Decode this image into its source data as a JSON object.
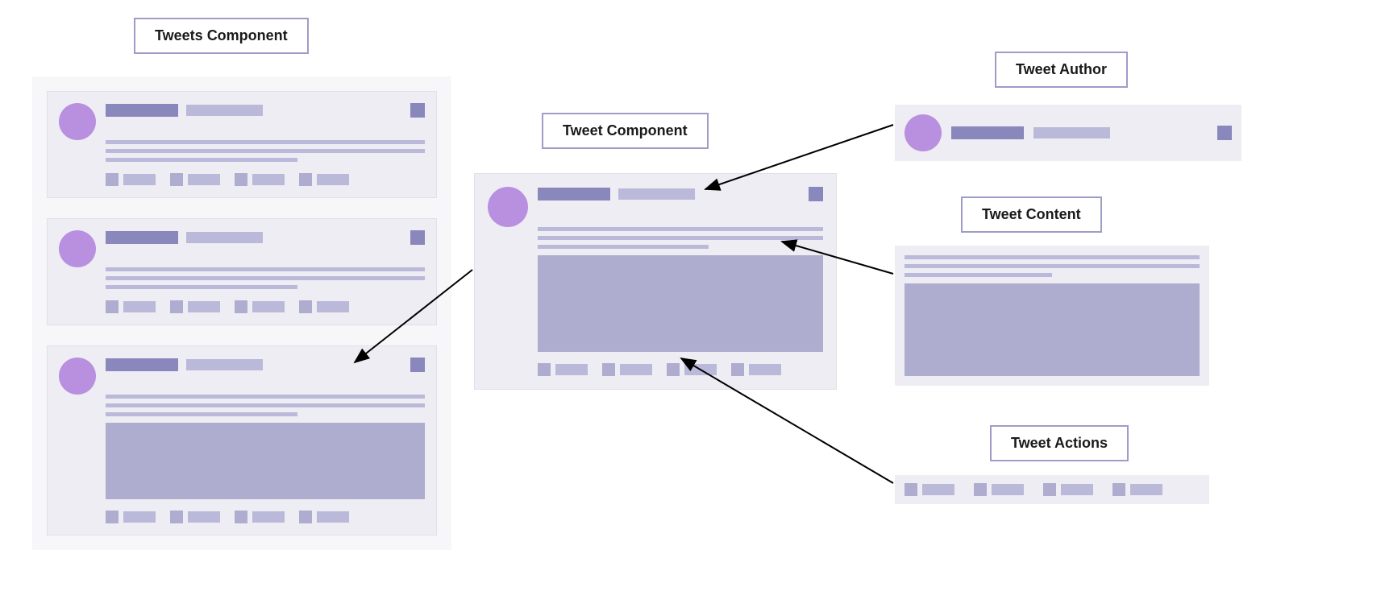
{
  "labels": {
    "tweets_component": "Tweets Component",
    "tweet_component": "Tweet Component",
    "tweet_author": "Tweet Author",
    "tweet_content": "Tweet Content",
    "tweet_actions": "Tweet Actions"
  },
  "colors": {
    "avatar": "#b98fe0",
    "dark_purple": "#8a87bc",
    "light_purple": "#bbb9da",
    "media_purple": "#aeaccf",
    "card_bg": "#ededf3",
    "list_bg": "#f7f7fa",
    "border": "#9e9cc8"
  },
  "diagram": {
    "tweets_list_count": 3,
    "tweet_has_media_index": 2,
    "action_count": 4
  }
}
